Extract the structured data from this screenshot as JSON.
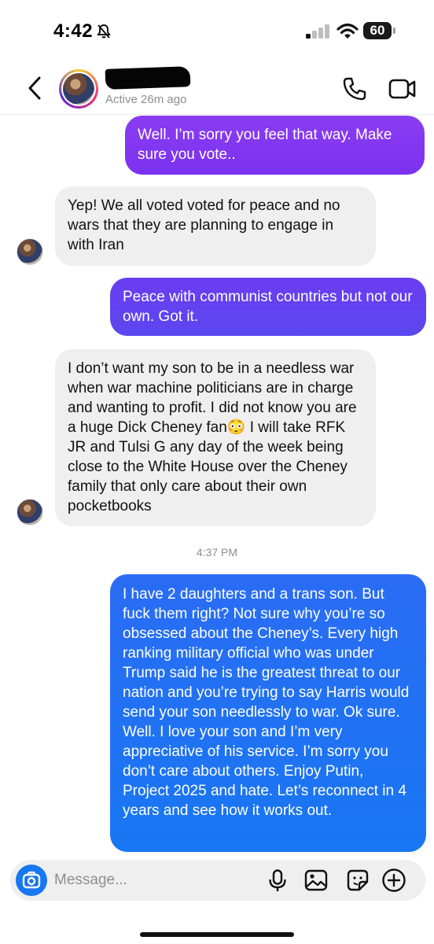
{
  "status_bar": {
    "time": "4:42",
    "battery": "60",
    "icons": [
      "bell-slash-icon",
      "signal-icon",
      "wifi-icon",
      "battery-icon"
    ]
  },
  "header": {
    "active_status": "Active 26m ago",
    "icons": [
      "chevron-left-icon",
      "phone-icon",
      "video-camera-icon"
    ]
  },
  "messages": [
    {
      "direction": "outgoing",
      "text": "Well. I’m sorry you feel that way. Make sure you vote.."
    },
    {
      "direction": "incoming",
      "text": "Yep! We all voted voted for peace and no wars that they are planning to engage in with Iran"
    },
    {
      "direction": "outgoing",
      "text": "Peace with communist countries but not our own. Got it."
    },
    {
      "direction": "incoming",
      "text": "I don’t want my son to be in a needless war when war machine politicians are in charge and wanting to profit. I did not know you are a huge Dick Cheney fan😳 I will take RFK JR and Tulsi G any day of the week being close to the White House over the Cheney family that only care about their own pocketbooks"
    },
    {
      "direction": "outgoing",
      "text": "I have 2 daughters and a trans son. But fuck them right? Not sure why you’re so obsessed about the Cheney’s. Every high ranking military official who was under Trump said he is the greatest threat to our nation and you’re trying to say Harris would send your son needlessly to war. Ok sure. Well. I love your son and I’m very appreciative of his service. I’m sorry you don’t care about others. Enjoy Putin, Project 2025 and hate. Let’s reconnect in 4 years and see how it works out."
    }
  ],
  "timestamp": "4:37 PM",
  "composer": {
    "placeholder": "Message...",
    "icons": [
      "camera-icon",
      "microphone-icon",
      "image-icon",
      "sticker-icon",
      "plus-icon"
    ]
  },
  "colors": {
    "outgoing_purple": "#8a3cf0",
    "outgoing_indigo": "#6a3df0",
    "outgoing_blue": "#1877f2",
    "incoming_gray": "#efefef",
    "secondary_text": "#8e8e8e"
  }
}
